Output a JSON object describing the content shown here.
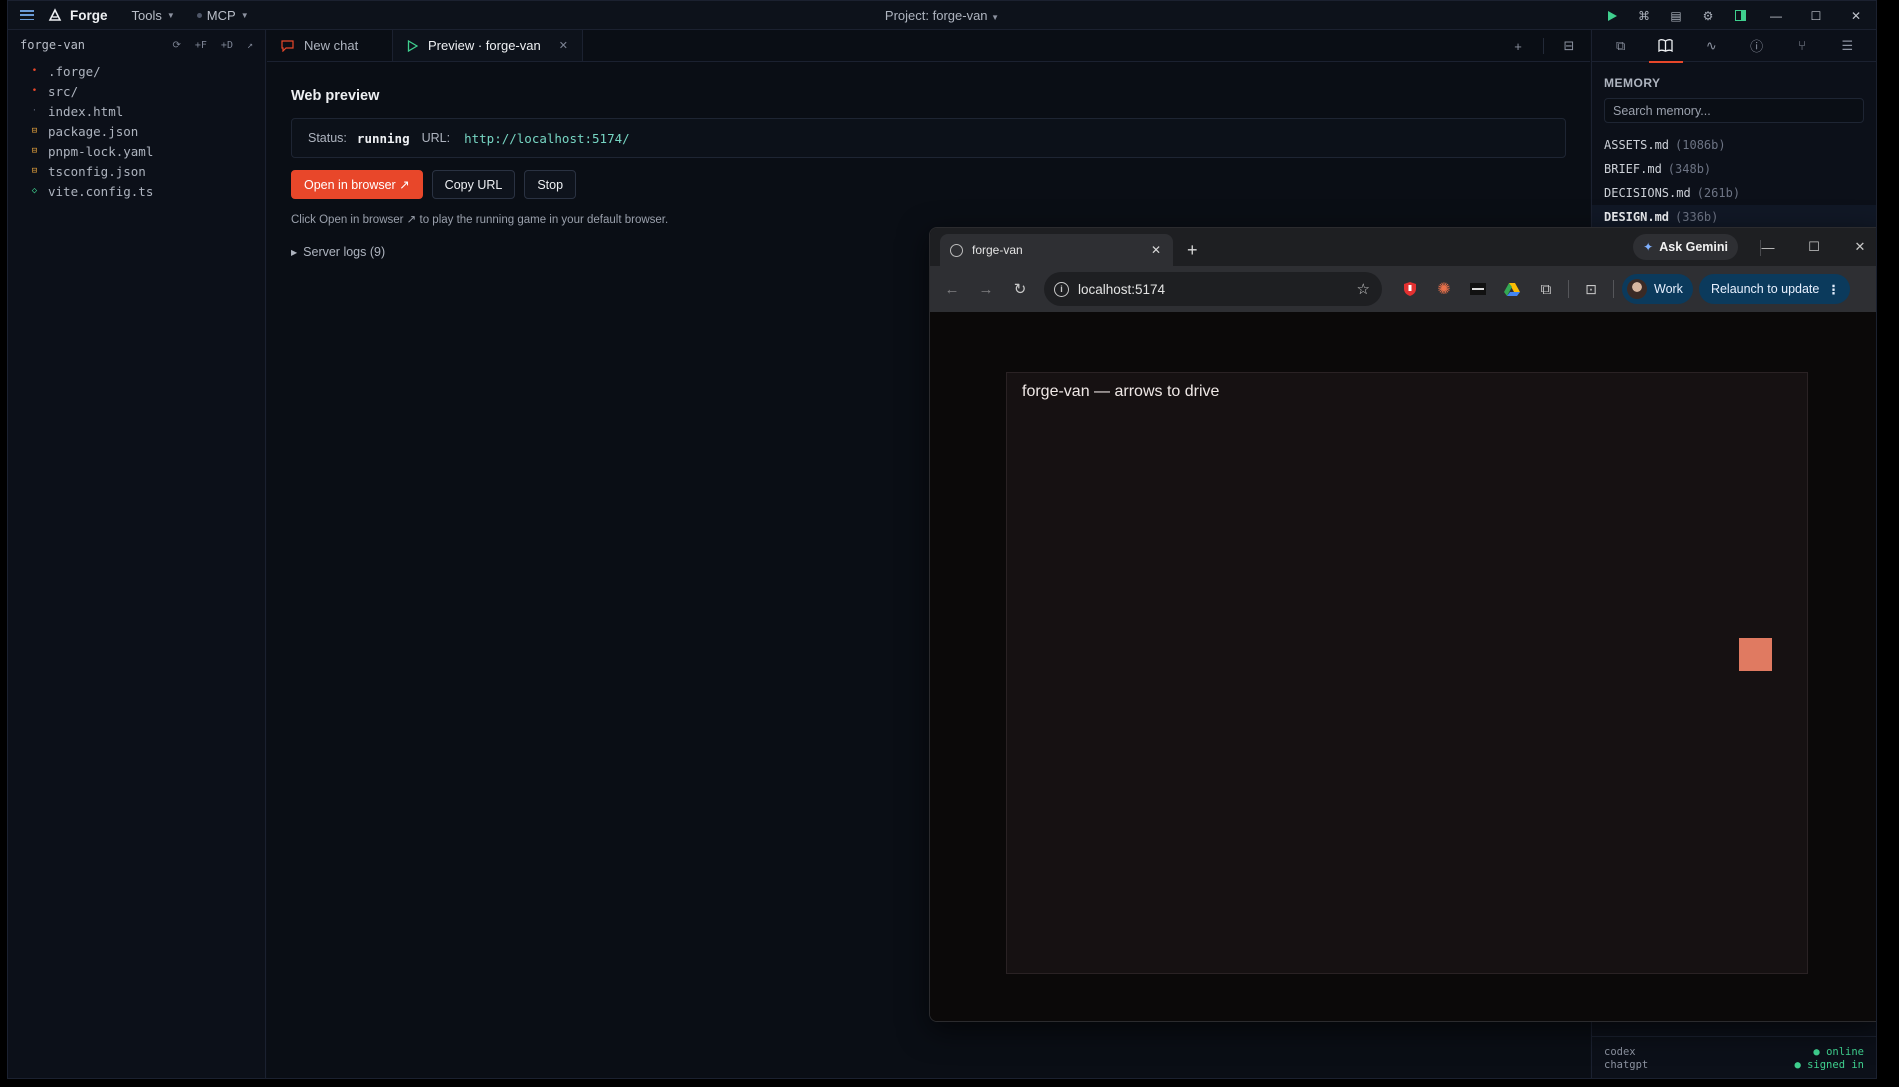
{
  "titlebar": {
    "app_name": "Forge",
    "menus": [
      {
        "label": "Tools"
      },
      {
        "label": "MCP"
      }
    ],
    "project_title": "Project: forge-van",
    "icons": [
      "play-icon",
      "command-icon",
      "list-icon",
      "gear-icon",
      "layout-icon"
    ]
  },
  "sidebar": {
    "project_name": "forge-van",
    "actions": [
      "⟳",
      "+F",
      "+D",
      "↗"
    ],
    "files": [
      {
        "name": ".forge/",
        "type": "folder"
      },
      {
        "name": "src/",
        "type": "folder"
      },
      {
        "name": "index.html",
        "type": "html"
      },
      {
        "name": "package.json",
        "type": "json"
      },
      {
        "name": "pnpm-lock.yaml",
        "type": "yaml"
      },
      {
        "name": "tsconfig.json",
        "type": "json"
      },
      {
        "name": "vite.config.ts",
        "type": "ts"
      }
    ]
  },
  "tabs": [
    {
      "label": "New chat",
      "active": false
    },
    {
      "label": "Preview · forge-van",
      "active": true
    }
  ],
  "preview": {
    "title": "Web preview",
    "status_label": "Status:",
    "status_value": "running",
    "url_label": "URL:",
    "url_value": "http://localhost:5174/",
    "open_button": "Open in browser ↗",
    "copy_button": "Copy URL",
    "stop_button": "Stop",
    "hint": "Click Open in browser ↗ to play the running game in your default browser.",
    "logs_label": "Server logs (9)"
  },
  "memory": {
    "title": "MEMORY",
    "search_placeholder": "Search memory...",
    "files": [
      {
        "name": "ASSETS.md",
        "size": "(1086b)"
      },
      {
        "name": "BRIEF.md",
        "size": "(348b)"
      },
      {
        "name": "DECISIONS.md",
        "size": "(261b)"
      },
      {
        "name": "DESIGN.md",
        "size": "(336b)"
      }
    ]
  },
  "footer": {
    "rows": [
      {
        "key": "codex",
        "value": "● online"
      },
      {
        "key": "chatgpt",
        "value": "● signed in"
      }
    ]
  },
  "browser": {
    "tab_title": "forge-van",
    "gemini_label": "Ask Gemini",
    "address": "localhost:5174",
    "profile_label": "Work",
    "relaunch_label": "Relaunch to update",
    "game_caption": "forge-van — arrows to drive"
  },
  "colors": {
    "accent": "#e8472a",
    "url": "#77d6c3",
    "online": "#3fcf8e",
    "van": "#e07a61"
  }
}
